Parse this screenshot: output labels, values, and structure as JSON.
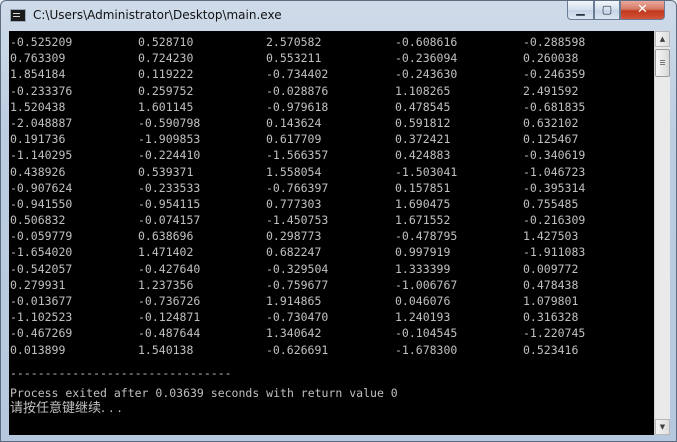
{
  "window": {
    "title": "C:\\Users\\Administrator\\Desktop\\main.exe",
    "controls": {
      "minimize": "▁",
      "maximize": "▢",
      "close": "✕"
    }
  },
  "console": {
    "rows": [
      [
        "-0.525209",
        "0.528710",
        "2.570582",
        "-0.608616",
        "-0.288598"
      ],
      [
        "0.763309",
        "0.724230",
        "0.553211",
        "-0.236094",
        "0.260038"
      ],
      [
        "1.854184",
        "0.119222",
        "-0.734402",
        "-0.243630",
        "-0.246359"
      ],
      [
        "-0.233376",
        "0.259752",
        "-0.028876",
        "1.108265",
        "2.491592"
      ],
      [
        "1.520438",
        "1.601145",
        "-0.979618",
        "0.478545",
        "-0.681835"
      ],
      [
        "-2.048887",
        "-0.590798",
        "0.143624",
        "0.591812",
        "0.632102"
      ],
      [
        "0.191736",
        "-1.909853",
        "0.617709",
        "0.372421",
        "0.125467"
      ],
      [
        "-1.140295",
        "-0.224410",
        "-1.566357",
        "0.424883",
        "-0.340619"
      ],
      [
        "0.438926",
        "0.539371",
        "1.558054",
        "-1.503041",
        "-1.046723"
      ],
      [
        "-0.907624",
        "-0.233533",
        "-0.766397",
        "0.157851",
        "-0.395314"
      ],
      [
        "-0.941550",
        "-0.954115",
        "0.777303",
        "1.690475",
        "0.755485"
      ],
      [
        "0.506832",
        "-0.074157",
        "-1.450753",
        "1.671552",
        "-0.216309"
      ],
      [
        "-0.059779",
        "0.638696",
        "0.298773",
        "-0.478795",
        "1.427503"
      ],
      [
        "-1.654020",
        "1.471402",
        "0.682247",
        "0.997919",
        "-1.911083"
      ],
      [
        "-0.542057",
        "-0.427640",
        "-0.329504",
        "1.333399",
        "0.009772"
      ],
      [
        "0.279931",
        "1.237356",
        "-0.759677",
        "-1.006767",
        "0.478438"
      ],
      [
        "-0.013677",
        "-0.736726",
        "1.914865",
        "0.046076",
        "1.079801"
      ],
      [
        "-1.102523",
        "-0.124871",
        "-0.730470",
        "1.240193",
        "0.316328"
      ],
      [
        "-0.467269",
        "-0.487644",
        "1.340642",
        "-0.104545",
        "-1.220745"
      ],
      [
        "0.013899",
        "1.540138",
        "-0.626691",
        "-1.678300",
        "0.523416"
      ]
    ],
    "separator": "--------------------------------",
    "exit_message": "Process exited after 0.03639 seconds with return value 0",
    "prompt": "请按任意键继续. . ."
  },
  "scrollbar": {
    "up_arrow": "▲",
    "down_arrow": "▼"
  }
}
